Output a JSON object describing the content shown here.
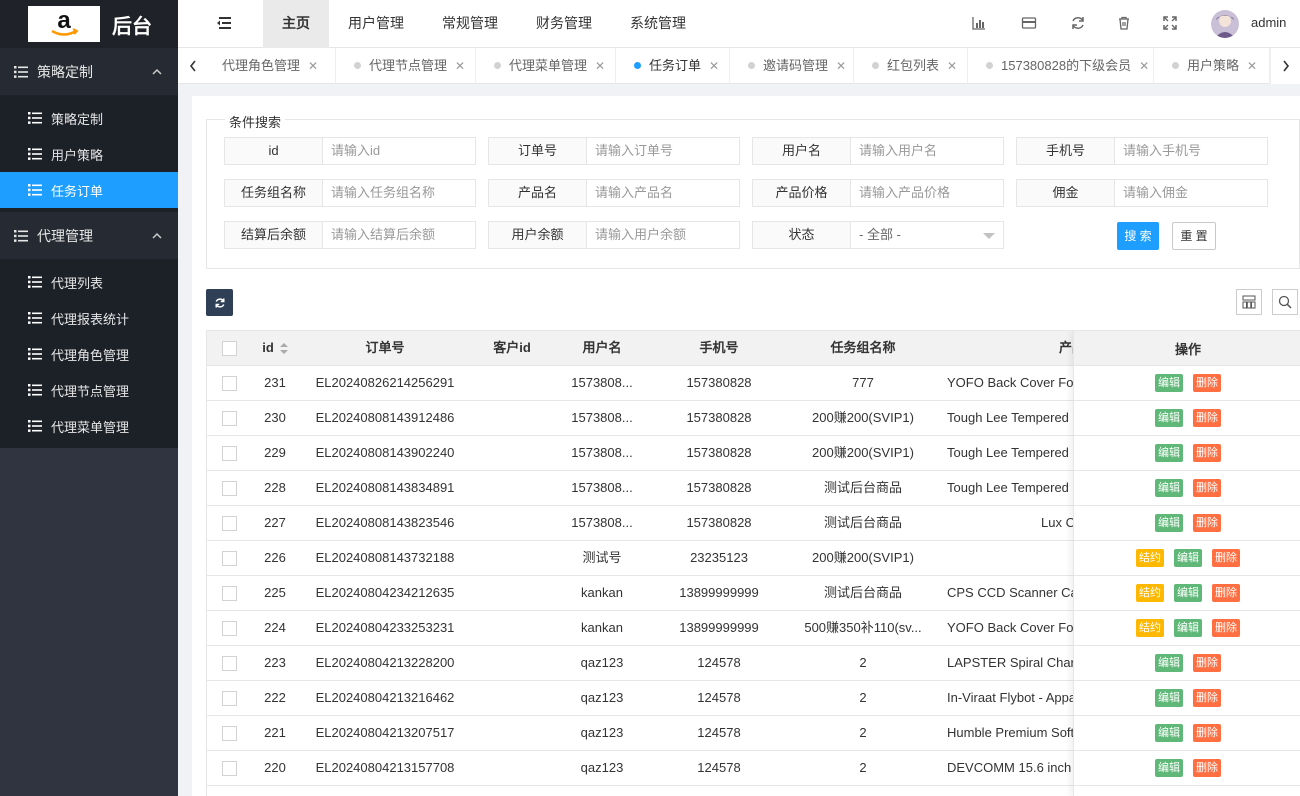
{
  "app": {
    "logo_text": "后台",
    "logo_letter": "a"
  },
  "sidebar": {
    "groups": [
      {
        "label": "策略定制",
        "items": [
          "策略定制",
          "用户策略",
          "任务订单"
        ]
      },
      {
        "label": "代理管理",
        "items": [
          "代理列表",
          "代理报表统计",
          "代理角色管理",
          "代理节点管理",
          "代理菜单管理"
        ]
      }
    ],
    "active_item": "任务订单"
  },
  "header": {
    "nav": [
      "主页",
      "用户管理",
      "常规管理",
      "财务管理",
      "系统管理"
    ],
    "active_nav": "主页",
    "user": "admin"
  },
  "tabs": [
    {
      "label": "代理角色管理",
      "active": false
    },
    {
      "label": "代理节点管理",
      "active": false
    },
    {
      "label": "代理菜单管理",
      "active": false
    },
    {
      "label": "任务订单",
      "active": true
    },
    {
      "label": "邀请码管理",
      "active": false
    },
    {
      "label": "红包列表",
      "active": false
    },
    {
      "label": "157380828的下级会员",
      "active": false
    },
    {
      "label": "用户策略",
      "active": false
    }
  ],
  "search": {
    "legend": "条件搜索",
    "fields": [
      {
        "label": "id",
        "placeholder": "请输入id"
      },
      {
        "label": "订单号",
        "placeholder": "请输入订单号"
      },
      {
        "label": "用户名",
        "placeholder": "请输入用户名"
      },
      {
        "label": "手机号",
        "placeholder": "请输入手机号"
      },
      {
        "label": "任务组名称",
        "placeholder": "请输入任务组名称"
      },
      {
        "label": "产品名",
        "placeholder": "请输入产品名"
      },
      {
        "label": "产品价格",
        "placeholder": "请输入产品价格"
      },
      {
        "label": "佣金",
        "placeholder": "请输入佣金"
      },
      {
        "label": "结算后余额",
        "placeholder": "请输入结算后余额"
      },
      {
        "label": "用户余额",
        "placeholder": "请输入用户余额"
      },
      {
        "label": "状态",
        "placeholder": "- 全部 -"
      }
    ],
    "search_btn": "搜 索",
    "reset_btn": "重 置"
  },
  "table": {
    "columns": [
      "id",
      "订单号",
      "客户id",
      "用户名",
      "手机号",
      "任务组名称",
      "产品"
    ],
    "action_header": "操作",
    "actions": {
      "settle": "结约",
      "edit": "编辑",
      "delete": "删除"
    },
    "rows": [
      {
        "id": "231",
        "order": "EL20240826214256291",
        "cust": "",
        "user": "1573808...",
        "phone": "157380828",
        "group": "777",
        "product": "YOFO Back Cover Fo",
        "settle": false
      },
      {
        "id": "230",
        "order": "EL20240808143912486",
        "cust": "",
        "user": "1573808...",
        "phone": "157380828",
        "group": "200赚200(SVIP1)",
        "product": "Tough Lee Tempered (",
        "settle": false
      },
      {
        "id": "229",
        "order": "EL20240808143902240",
        "cust": "",
        "user": "1573808...",
        "phone": "157380828",
        "group": "200赚200(SVIP1)",
        "product": "Tough Lee Tempered (",
        "settle": false
      },
      {
        "id": "228",
        "order": "EL20240808143834891",
        "cust": "",
        "user": "1573808...",
        "phone": "157380828",
        "group": "测试后台商品",
        "product": "Tough Lee Tempered (",
        "settle": false
      },
      {
        "id": "227",
        "order": "EL20240808143823546",
        "cust": "",
        "user": "1573808...",
        "phone": "157380828",
        "group": "测试后台商品",
        "product": "Lux C",
        "settle": false
      },
      {
        "id": "226",
        "order": "EL20240808143732188",
        "cust": "",
        "user": "测试号",
        "phone": "23235123",
        "group": "200赚200(SVIP1)",
        "product": "",
        "settle": true
      },
      {
        "id": "225",
        "order": "EL20240804234212635",
        "cust": "",
        "user": "kankan",
        "phone": "13899999999",
        "group": "测试后台商品",
        "product": "CPS CCD Scanner Ca",
        "settle": true
      },
      {
        "id": "224",
        "order": "EL20240804233253231",
        "cust": "",
        "user": "kankan",
        "phone": "13899999999",
        "group": "500赚350补110(sv...",
        "product": "YOFO Back Cover Fo",
        "settle": true
      },
      {
        "id": "223",
        "order": "EL20240804213228200",
        "cust": "",
        "user": "qaz123",
        "phone": "124578",
        "group": "2",
        "product": "LAPSTER Spiral Char",
        "settle": false
      },
      {
        "id": "222",
        "order": "EL20240804213216462",
        "cust": "",
        "user": "qaz123",
        "phone": "124578",
        "group": "2",
        "product": "In-Viraat Flybot - Appa",
        "settle": false
      },
      {
        "id": "221",
        "order": "EL20240804213207517",
        "cust": "",
        "user": "qaz123",
        "phone": "124578",
        "group": "2",
        "product": "Humble Premium Soft",
        "settle": false
      },
      {
        "id": "220",
        "order": "EL20240804213157708",
        "cust": "",
        "user": "qaz123",
        "phone": "124578",
        "group": "2",
        "product": "DEVCOMM 15.6 inch",
        "settle": false
      }
    ]
  },
  "colors": {
    "primary": "#1e9fff",
    "sidebar": "#2f3440",
    "edit": "#5fb878",
    "delete": "#ff5722",
    "settle": "#ffb800"
  }
}
